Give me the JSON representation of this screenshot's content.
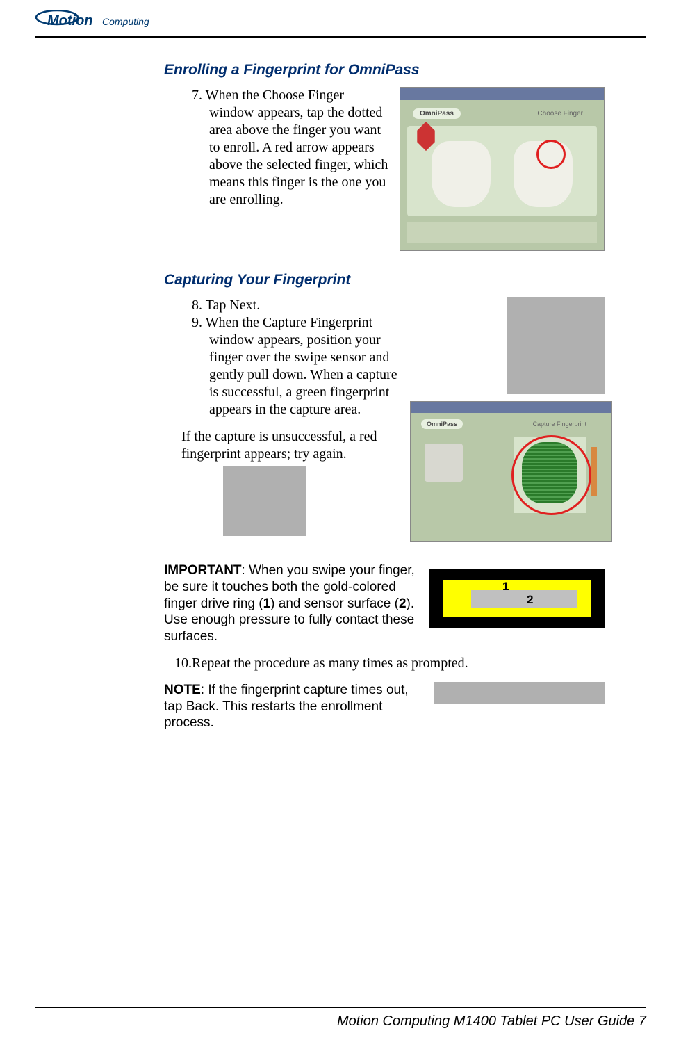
{
  "logo": {
    "brand": "Motion",
    "sub": "Computing"
  },
  "section1": {
    "heading": "Enrolling a Fingerprint for OmniPass",
    "step7_num": "7. ",
    "step7_text": "When the Choose Finger window appears, tap the dotted area above the finger you want to enroll. A red arrow appears above the selected finger, which means this finger is the one you are enrolling.",
    "screenshot1_omnipass": "OmniPass",
    "screenshot1_title": "Choose Finger"
  },
  "section2": {
    "heading": "Capturing Your Fingerprint",
    "step8_num": "8. ",
    "step8_text": "Tap Next.",
    "step9_num": "9. ",
    "step9_text": "When the Capture Fingerprint window appears, position your finger over the swipe sensor and gently pull down. When a capture is successful, a green fingerprint appears in the capture area.",
    "unsuccessful": "If the capture is unsuccessful, a red fingerprint appears; try again.",
    "screenshot2_omnipass": "OmniPass",
    "screenshot2_title": "Capture Fingerprint"
  },
  "important": {
    "label": "IMPORTANT",
    "text_part1": ": When you swipe your finger, be sure it touches both the gold-colored finger drive ring (",
    "num1": "1",
    "text_part2": ") and sensor surface (",
    "num2": "2",
    "text_part3": "). Use enough pressure to fully contact these surfaces.",
    "diagram_1": "1",
    "diagram_2": "2"
  },
  "step10": {
    "num": "10.",
    "text": "Repeat the procedure as many times as prompted."
  },
  "note": {
    "label": "NOTE",
    "text": ": If the fingerprint capture times out, tap Back. This restarts the enrollment process."
  },
  "footer": {
    "text": "Motion Computing M1400 Tablet PC User Guide 7"
  }
}
